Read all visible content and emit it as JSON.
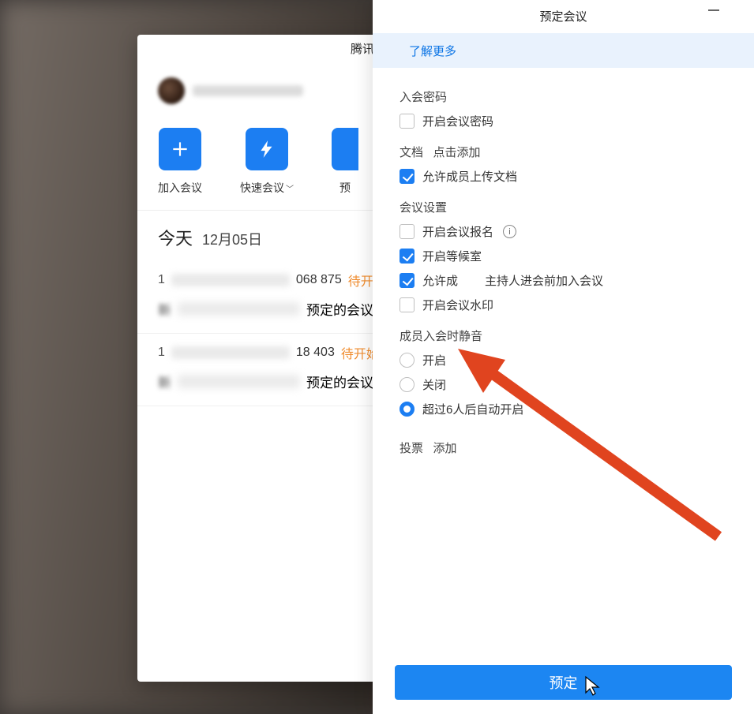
{
  "mainWindow": {
    "title": "腾讯会议",
    "actions": {
      "join": "加入会议",
      "quick": "快速会议",
      "schedulePrefix": "预"
    },
    "today": {
      "label": "今天",
      "date": "12月05日"
    },
    "meetings": [
      {
        "numberTail": "068 875",
        "status": "待开始",
        "titleTail": "预定的会议"
      },
      {
        "numberTail": "18 403",
        "status": "待开始",
        "titleTail": "预定的会议"
      }
    ]
  },
  "dialog": {
    "title": "预定会议",
    "learnMore": "了解更多",
    "password": {
      "sectionTitle": "入会密码",
      "enable": {
        "label": "开启会议密码",
        "checked": false
      }
    },
    "docs": {
      "sectionTitle": "文档",
      "addLink": "点击添加",
      "allowUpload": {
        "label": "允许成员上传文档",
        "checked": true
      }
    },
    "settings": {
      "sectionTitle": "会议设置",
      "signup": {
        "label": "开启会议报名",
        "checked": false
      },
      "waitingRoom": {
        "label": "开启等候室",
        "checked": true
      },
      "allowBeforeHost": {
        "labelLeft": "允许成",
        "labelRight": "主持人进会前加入会议",
        "checked": true
      },
      "watermark": {
        "label": "开启会议水印",
        "checked": false
      }
    },
    "mute": {
      "sectionTitle": "成员入会时静音",
      "on": "开启",
      "off": "关闭",
      "auto6": "超过6人后自动开启",
      "selected": "auto6"
    },
    "vote": {
      "sectionTitle": "投票",
      "addLink": "添加"
    },
    "submit": "预定"
  }
}
